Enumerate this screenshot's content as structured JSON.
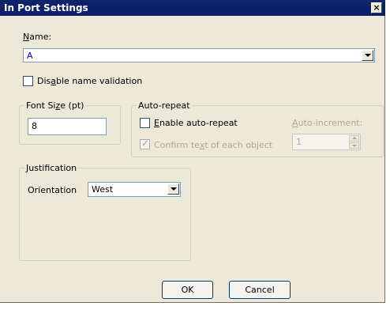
{
  "window": {
    "title": "In Port Settings",
    "close_glyph": "×"
  },
  "name": {
    "label_pre": "",
    "label_ul": "N",
    "label_post": "ame:",
    "value": "A"
  },
  "disable_validation": {
    "label_pre": "Dis",
    "label_ul": "a",
    "label_post": "ble name validation",
    "checked": false
  },
  "font_size": {
    "title_pre": "Font Si",
    "title_ul": "z",
    "title_post": "e (pt)",
    "value": "8"
  },
  "auto_repeat": {
    "title": "Auto-repeat",
    "enable": {
      "label_pre": "",
      "label_ul": "E",
      "label_post": "nable auto-repeat",
      "checked": false
    },
    "confirm": {
      "label_pre": "Confirm te",
      "label_ul": "x",
      "label_post": "t of each object",
      "checked": true,
      "check_glyph": "✓"
    },
    "increment": {
      "label_pre": "",
      "label_ul": "A",
      "label_post": "uto-increment:",
      "value": "1"
    }
  },
  "justification": {
    "title": "Justification",
    "orientation_label": "Orientation",
    "orientation_value": "West"
  },
  "buttons": {
    "ok": "OK",
    "cancel": "Cancel"
  },
  "colors": {
    "titlebar": "#0a246a",
    "dialog_bg": "#ece9d8",
    "disabled_text": "#aca899"
  }
}
